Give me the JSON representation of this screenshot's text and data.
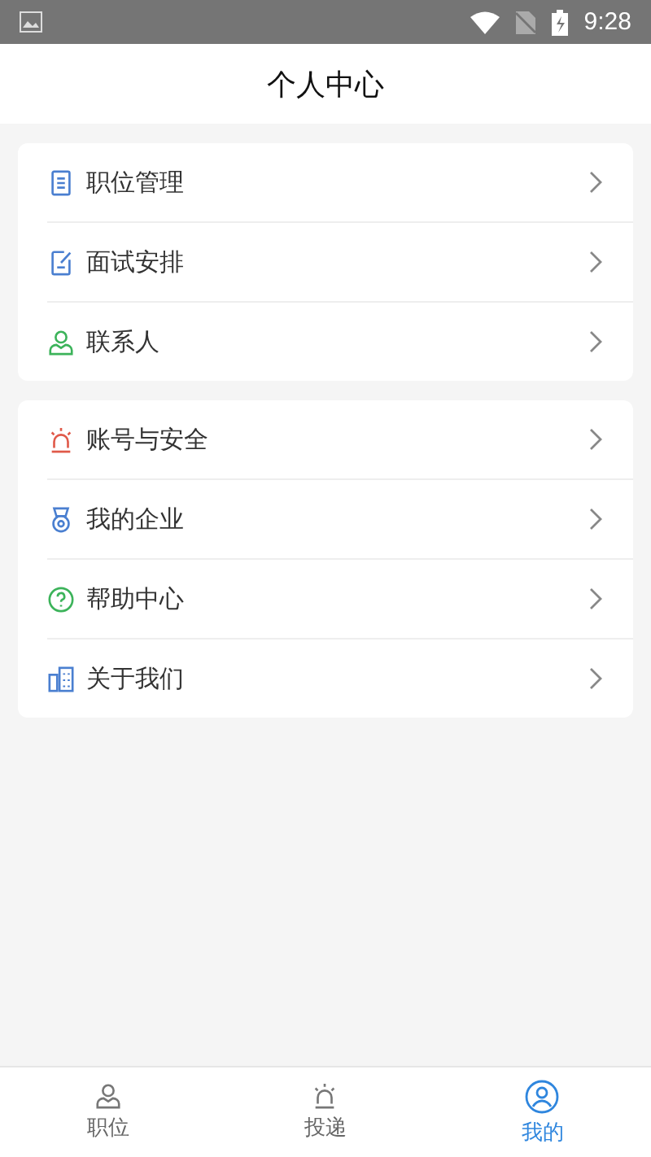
{
  "status_bar": {
    "time": "9:28"
  },
  "header": {
    "title": "个人中心"
  },
  "groups": [
    {
      "items": [
        {
          "label": "职位管理",
          "kind": "document"
        },
        {
          "label": "面试安排",
          "kind": "edit"
        },
        {
          "label": "联系人",
          "kind": "person"
        }
      ]
    },
    {
      "items": [
        {
          "label": "账号与安全",
          "kind": "alarm"
        },
        {
          "label": "我的企业",
          "kind": "medal"
        },
        {
          "label": "帮助中心",
          "kind": "help"
        },
        {
          "label": "关于我们",
          "kind": "building"
        }
      ]
    }
  ],
  "tabs": [
    {
      "label": "职位",
      "kind": "person",
      "selected": false
    },
    {
      "label": "投递",
      "kind": "alarm",
      "selected": false
    },
    {
      "label": "我的",
      "kind": "profile",
      "selected": true
    }
  ]
}
